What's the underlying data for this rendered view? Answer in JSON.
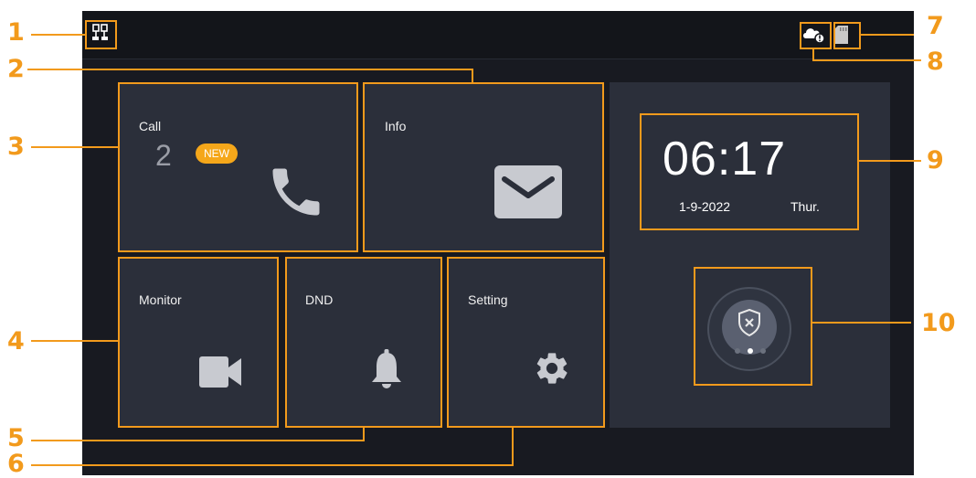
{
  "status_bar": {
    "network_icon": "network-icon",
    "cloud_icon": "cloud-alert-icon",
    "sd_card_icon": "sd-card-icon"
  },
  "tiles": {
    "call": {
      "label": "Call",
      "count": "2",
      "badge": "NEW",
      "icon": "phone-icon"
    },
    "info": {
      "label": "Info",
      "icon": "envelope-icon"
    },
    "monitor": {
      "label": "Monitor",
      "icon": "video-camera-icon"
    },
    "dnd": {
      "label": "DND",
      "icon": "bell-icon"
    },
    "setting": {
      "label": "Setting",
      "icon": "gear-icon"
    }
  },
  "clock": {
    "time": "06:17",
    "date": "1-9-2022",
    "weekday": "Thur."
  },
  "arm_button": {
    "icon": "shield-x-icon",
    "page_dots": 3,
    "active_dot": 2
  },
  "callouts": [
    "1",
    "2",
    "3",
    "4",
    "5",
    "6",
    "7",
    "8",
    "9",
    "10"
  ],
  "colors": {
    "accent": "#f29a1c",
    "badge": "#f5a71a",
    "tile": "#2b2f3a",
    "screen": "#181a21"
  }
}
